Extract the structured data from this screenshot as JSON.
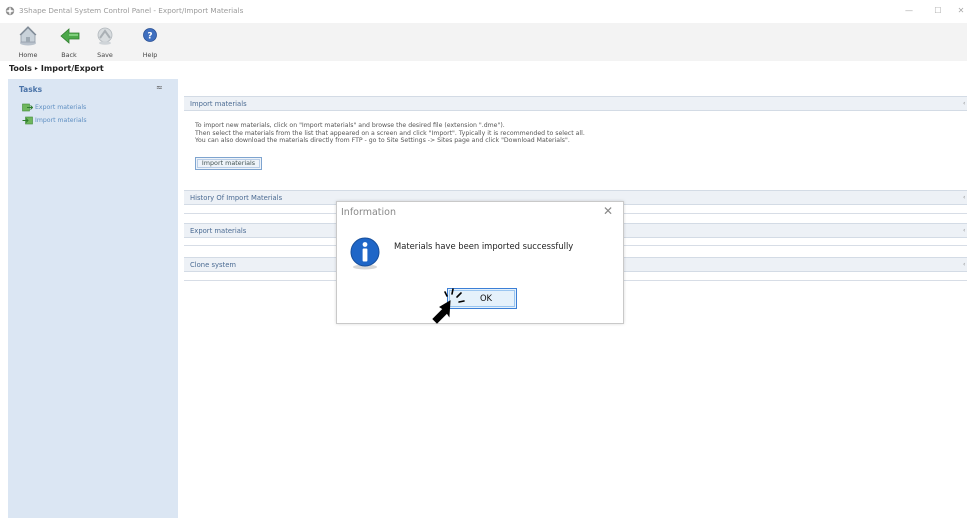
{
  "window": {
    "title": "3Shape Dental System Control Panel - Export/Import Materials",
    "minimize_glyph": "—",
    "maximize_glyph": "☐",
    "close_glyph": "✕"
  },
  "toolbar": {
    "home_label": "Home",
    "back_label": "Back",
    "save_label": "Save",
    "help_label": "Help",
    "icons": [
      "home-icon",
      "back-arrow-icon",
      "save-icon",
      "help-icon"
    ]
  },
  "breadcrumb": {
    "root": "Tools",
    "separator": "▸",
    "current": "Import/Export"
  },
  "sidebar": {
    "title": "Tasks",
    "collapse_glyph": "≈",
    "items": [
      {
        "label": "Export materials",
        "icon": "export-icon"
      },
      {
        "label": "Import materials",
        "icon": "import-icon"
      }
    ]
  },
  "sections": {
    "import": {
      "title": "Import materials",
      "lines": [
        "To import new materials, click on \"Import materials\" and browse the desired file (extension \".dme\").",
        "Then select the materials from the list that appeared on a screen and click \"Import\". Typically it is recommended to select all.",
        "You can also download the materials directly from FTP - go to Site Settings -> Sites page and click \"Download Materials\"."
      ],
      "button_label": "Import materials"
    },
    "history": {
      "title": "History Of Import Materials"
    },
    "export": {
      "title": "Export materials"
    },
    "clone": {
      "title": "Clone system"
    }
  },
  "dialog": {
    "title": "Information",
    "close_glyph": "✕",
    "message": "Materials have been imported successfully",
    "ok_label": "OK",
    "icon": "info-icon"
  },
  "colors": {
    "sidebar_bg": "#dbe6f3",
    "section_bar_bg": "#edf1f6",
    "link_blue": "#5f8fc2",
    "dialog_button_border": "#3c7fd6"
  }
}
